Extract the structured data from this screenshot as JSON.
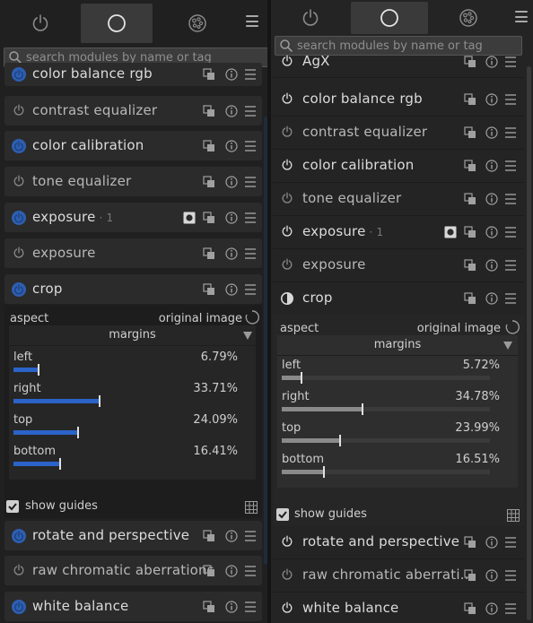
{
  "search_placeholder": "search modules by name or tag",
  "left": {
    "modules": {
      "color_balance_rgb": "color balance rgb",
      "contrast_equalizer": "contrast equalizer",
      "color_calibration": "color calibration",
      "tone_equalizer": "tone equalizer",
      "exposure_1": "exposure",
      "exposure_1_instance": "· 1",
      "exposure": "exposure",
      "crop": "crop",
      "rotate_and_perspective": "rotate and perspective",
      "raw_chromatic_aberrations": "raw chromatic aberrations",
      "white_balance": "white balance"
    },
    "crop": {
      "aspect_label": "aspect",
      "aspect_value": "original image",
      "margins_label": "margins",
      "left_label": "left",
      "left_value": "6.79%",
      "left_level": 0.0679,
      "right_label": "right",
      "right_value": "33.71%",
      "right_level": 0.3371,
      "top_label": "top",
      "top_value": "24.09%",
      "top_level": 0.2409,
      "bottom_label": "bottom",
      "bottom_value": "16.41%",
      "bottom_level": 0.1641
    },
    "show_guides": "show guides"
  },
  "right": {
    "modules": {
      "agx": "AgX",
      "color_balance_rgb": "color balance rgb",
      "contrast_equalizer": "contrast equalizer",
      "color_calibration": "color calibration",
      "tone_equalizer": "tone equalizer",
      "exposure_1": "exposure",
      "exposure_1_instance": "· 1",
      "exposure": "exposure",
      "crop": "crop",
      "rotate_and_perspective": "rotate and perspective",
      "raw_chromatic_aberrations": "raw chromatic aberrati…",
      "white_balance": "white balance"
    },
    "crop": {
      "aspect_label": "aspect",
      "aspect_value": "original image",
      "margins_label": "margins",
      "left_label": "left",
      "left_value": "5.72%",
      "left_level": 0.0572,
      "right_label": "right",
      "right_value": "34.78%",
      "right_level": 0.3478,
      "top_label": "top",
      "top_value": "23.99%",
      "top_level": 0.2399,
      "bottom_label": "bottom",
      "bottom_value": "16.51%",
      "bottom_level": 0.1651
    },
    "show_guides": "show guides"
  },
  "colors": {
    "accent_blue": "#2d5fb2",
    "bar_blue": "#2b63c9",
    "bar_grey": "#8a8a8a"
  },
  "icons": [
    "power-icon",
    "circle-icon",
    "palette-icon",
    "hamburger-icon",
    "search-icon",
    "copy-icon",
    "info-icon",
    "menu-icon",
    "reset-icon",
    "grid-icon",
    "checkbox-icon",
    "mask-icon"
  ]
}
